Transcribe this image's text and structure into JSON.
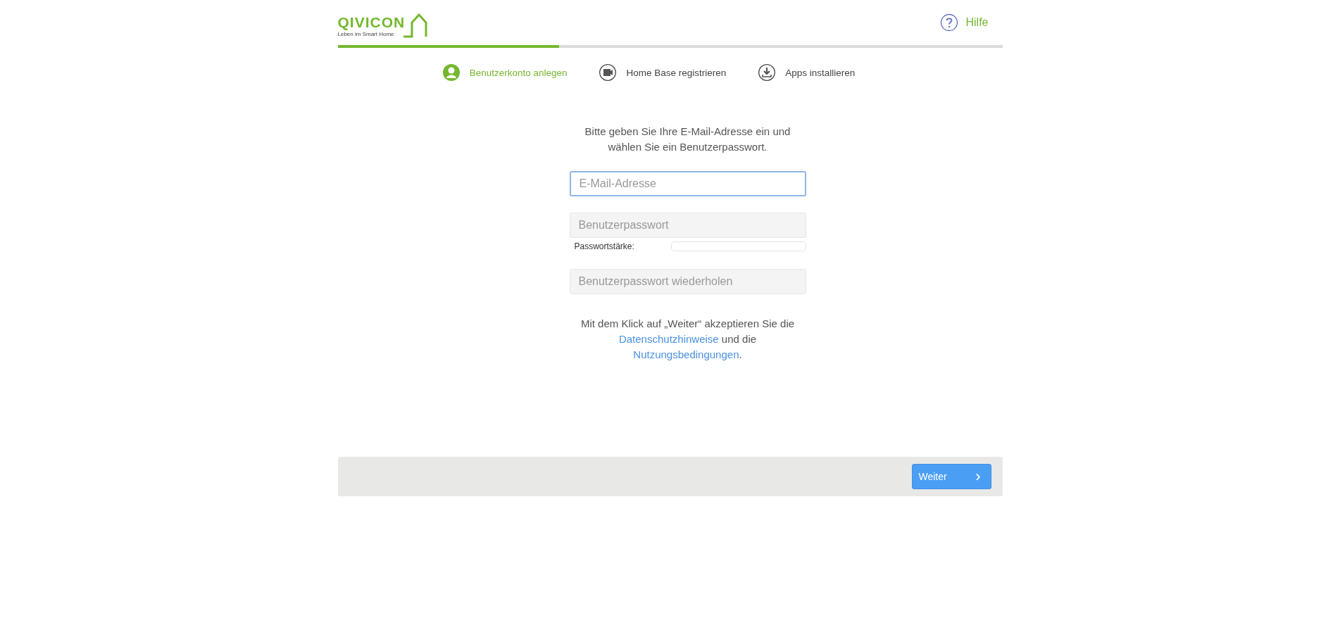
{
  "header": {
    "logo": {
      "name": "QIVICON",
      "tagline": "Leben im Smart Home"
    },
    "help": {
      "label": "Hilfe"
    }
  },
  "progress": {
    "level": 0.333
  },
  "steps": [
    {
      "label": "Benutzerkonto anlegen",
      "kind": "user",
      "selected": true
    },
    {
      "label": "Home Base registrieren",
      "kind": "device",
      "selected": false
    },
    {
      "label": "Apps installieren",
      "kind": "download",
      "selected": false
    }
  ],
  "form": {
    "intro": "Bitte geben Sie Ihre E-Mail-Adresse ein und wählen Sie ein Benutzerpasswort.",
    "fields": [
      {
        "kind": "email",
        "placeholder": "E-Mail-Adresse",
        "focused": true
      },
      {
        "kind": "password",
        "placeholder": "Benutzerpasswort",
        "focused": false
      },
      {
        "kind": "strength",
        "label": "Passwortstärke:",
        "level": 0
      },
      {
        "kind": "password",
        "placeholder": "Benutzerpasswort wiederholen",
        "focused": false
      }
    ],
    "legal": [
      {
        "kind": "text",
        "text": "Mit dem Klick auf „Weiter“ akzeptieren Sie die"
      },
      {
        "kind": "link",
        "text": "Datenschutzhinweise"
      },
      {
        "kind": "text",
        "text": "und die"
      },
      {
        "kind": "link",
        "text": "Nutzungsbedingungen"
      },
      {
        "kind": "text",
        "text": "."
      }
    ]
  },
  "footer": {
    "button": {
      "label": "Weiter",
      "icon": "›"
    }
  }
}
